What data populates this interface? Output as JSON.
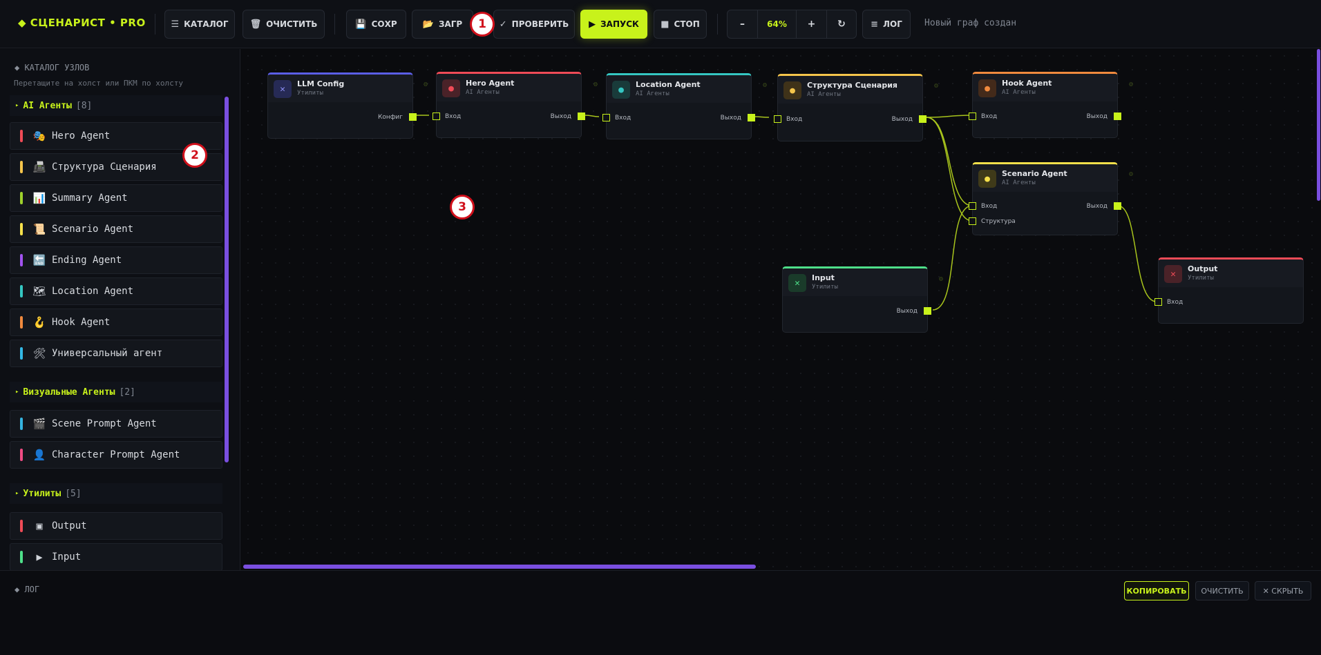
{
  "app": {
    "brand": "◆ СЦЕНАРИСТ • PRO"
  },
  "toolbar": {
    "catalog": "КАТАЛОГ",
    "clear": "ОЧИСТИТЬ",
    "save": "СОХР",
    "load": "ЗАГР",
    "check": "ПРОВЕРИТЬ",
    "run": "ЗАПУСК",
    "stop": "СТОП",
    "zoom_out": "–",
    "zoom": "64%",
    "zoom_in": "+",
    "reset": "↻",
    "log": "ЛОГ",
    "status": "Новый граф создан"
  },
  "badges": [
    "1",
    "2",
    "3"
  ],
  "sidebar": {
    "title": "◆ КАТАЛОГ УЗЛОВ",
    "hint": "Перетащите на холст или ПКМ по холсту",
    "sections": [
      {
        "name": "AI Агенты",
        "count": "[8]",
        "items": [
          {
            "label": "Hero Agent",
            "icon": "🎭",
            "color": "#ef4b57"
          },
          {
            "label": "Структура Сценария",
            "icon": "📠",
            "color": "#f5c54b"
          },
          {
            "label": "Summary Agent",
            "icon": "📊",
            "color": "#9ed12b"
          },
          {
            "label": "Scenario Agent",
            "icon": "📜",
            "color": "#f5e04b"
          },
          {
            "label": "Ending Agent",
            "icon": "🔚",
            "color": "#a253f0"
          },
          {
            "label": "Location Agent",
            "icon": "🗺",
            "color": "#35c7c2"
          },
          {
            "label": "Hook Agent",
            "icon": "🪝",
            "color": "#f08a3e"
          },
          {
            "label": "Универсальный агент",
            "icon": "🛠",
            "color": "#33b9e6"
          }
        ]
      },
      {
        "name": "Визуальные Агенты",
        "count": "[2]",
        "items": [
          {
            "label": "Scene Prompt Agent",
            "icon": "🎬",
            "color": "#35b4e0"
          },
          {
            "label": "Character Prompt Agent",
            "icon": "👤",
            "color": "#ef4b83"
          }
        ]
      },
      {
        "name": "Утилиты",
        "count": "[5]",
        "items": [
          {
            "label": "Output",
            "icon": "▣",
            "color": "#ef4b57"
          },
          {
            "label": "Input",
            "icon": "▶",
            "color": "#4ee08a"
          }
        ]
      }
    ]
  },
  "nodes": {
    "llm_config": {
      "title": "LLM Config",
      "subtitle": "Утилиты",
      "out": "Конфиг",
      "color": "#5b5ee6"
    },
    "hero": {
      "title": "Hero Agent",
      "subtitle": "AI Агенты",
      "in": "Вход",
      "out": "Выход",
      "color": "#ef4b57"
    },
    "location": {
      "title": "Location Agent",
      "subtitle": "AI Агенты",
      "in": "Вход",
      "out": "Выход",
      "color": "#35c7c2"
    },
    "structure": {
      "title": "Структура Сценария",
      "subtitle": "AI Агенты",
      "in": "Вход",
      "out": "Выход",
      "color": "#f5c54b"
    },
    "hook": {
      "title": "Hook Agent",
      "subtitle": "AI Агенты",
      "in": "Вход",
      "out": "Выход",
      "color": "#f08a3e"
    },
    "scenario": {
      "title": "Scenario Agent",
      "subtitle": "AI Агенты",
      "in": "Вход",
      "in2": "Структура",
      "out": "Выход",
      "color": "#f5e04b"
    },
    "input": {
      "title": "Input",
      "subtitle": "Утилиты",
      "out": "Выход",
      "color": "#4ee08a"
    },
    "output": {
      "title": "Output",
      "subtitle": "Утилиты",
      "in": "Вход",
      "color": "#ef4b57"
    }
  },
  "log": {
    "title": "◆ ЛОГ",
    "copy": "КОПИРОВАТЬ",
    "clear": "ОЧИСТИТЬ",
    "hide": "✕ СКРЫТЬ"
  }
}
